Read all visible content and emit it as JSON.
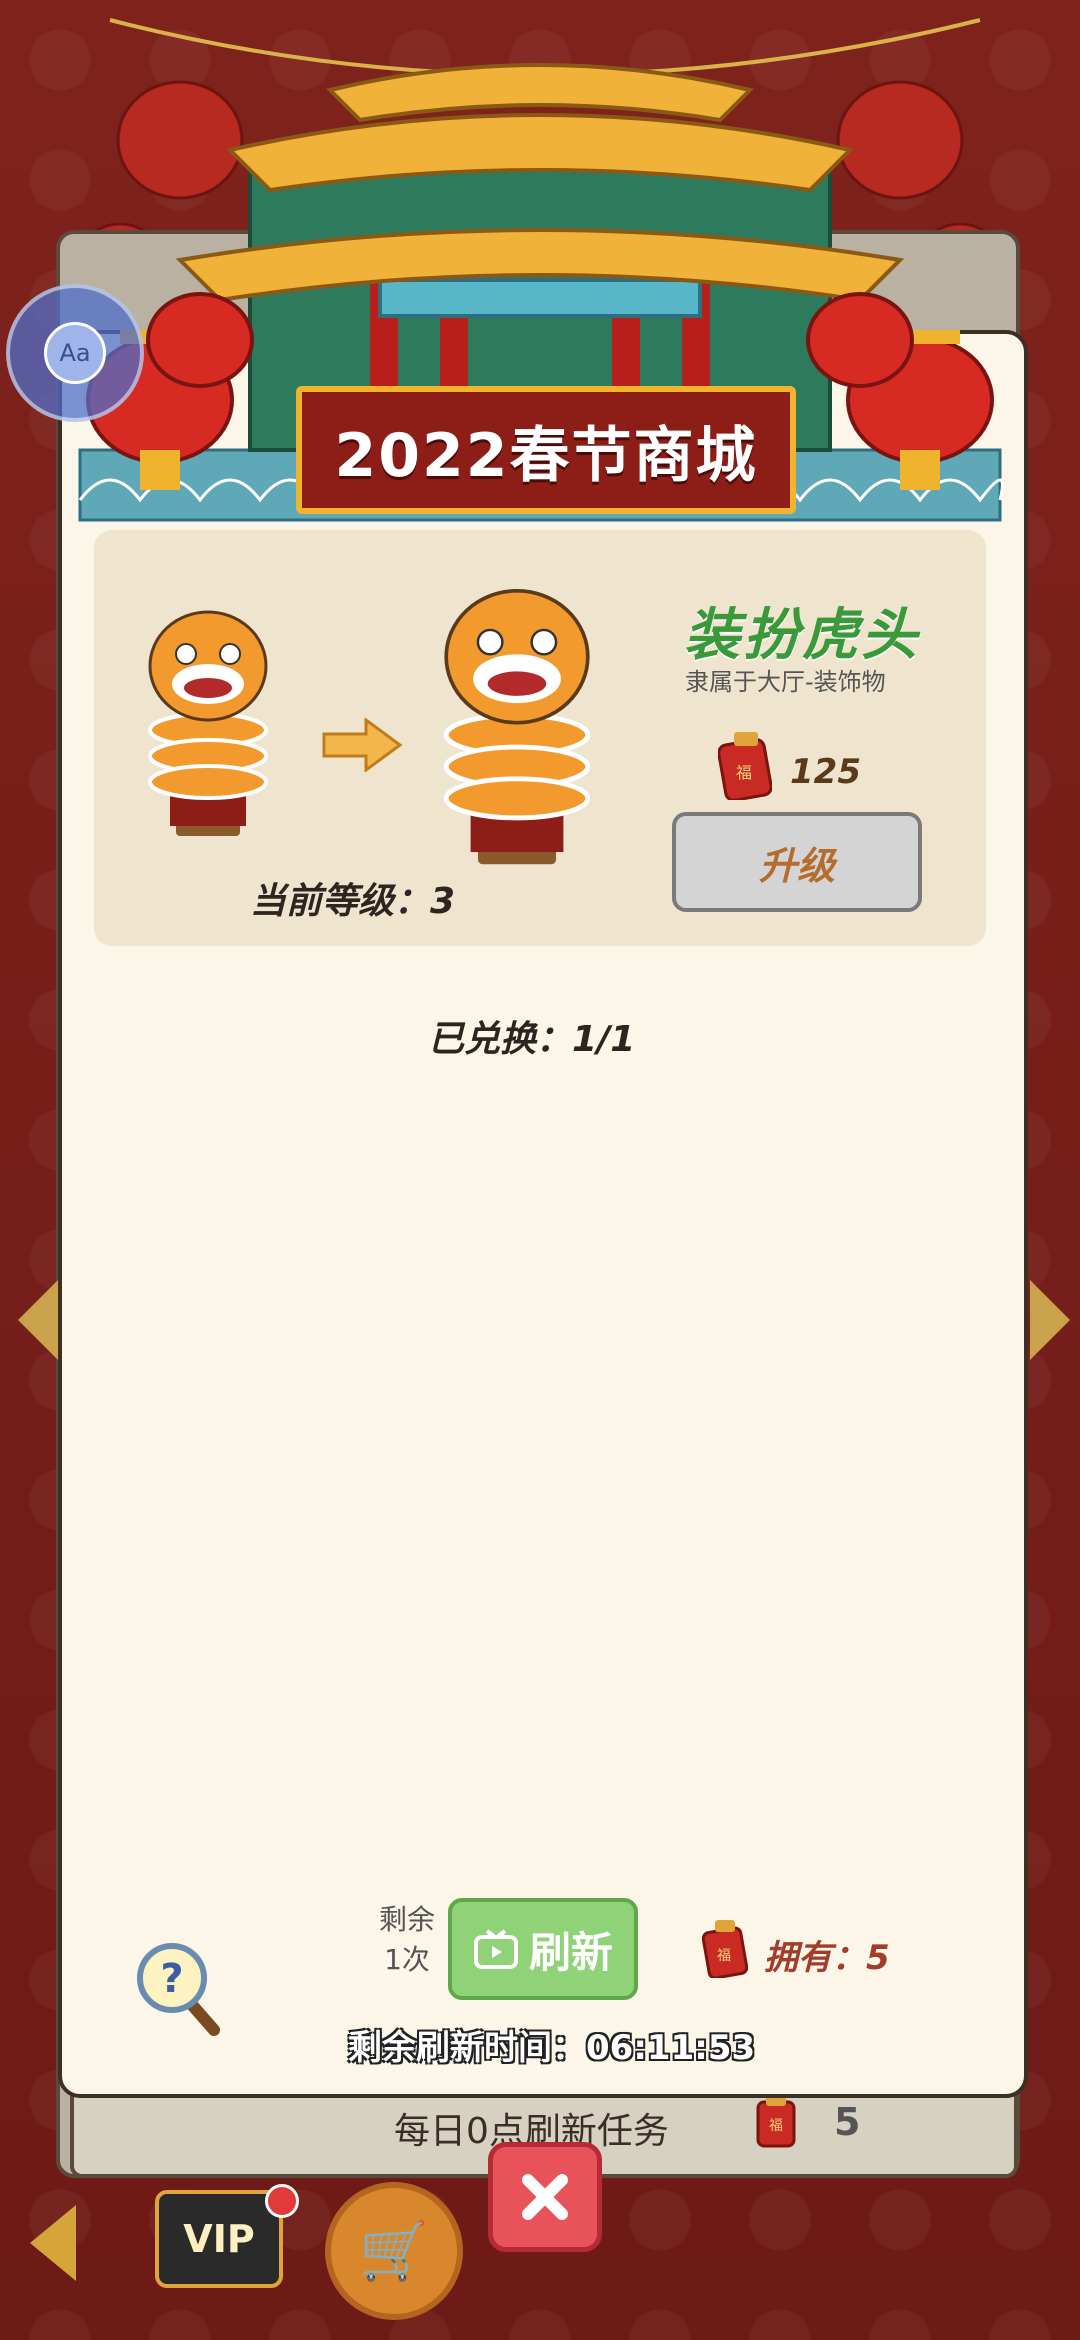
{
  "title": "2022春节商城",
  "item": {
    "name": "装扮虎头",
    "subtitle": "隶属于大厅-装饰物",
    "cost": "125",
    "upgrade_label": "升级",
    "current_level_text": "当前等级：3"
  },
  "exchanged_text": "已兑换：1/1",
  "refresh": {
    "remaining_label": "剩余\n1次",
    "button_label": "刷新",
    "own_text": "拥有：5",
    "time_label": "剩余刷新时间：06:11:53"
  },
  "background": {
    "daily_text": "每日0点刷新任务",
    "daily_count": "5",
    "vip_label": "VIP"
  },
  "accessibility_button": "Aa",
  "icons": [
    "lantern-icon",
    "red-envelope-icon",
    "tv-icon",
    "help-magnifier-icon",
    "close-icon",
    "cart-icon",
    "arrow-right-icon"
  ],
  "colors": {
    "accent_green": "#3a9a3a",
    "refresh_green": "#8fd277",
    "plaque_red": "#8d1d17",
    "close_red": "#e8535a"
  }
}
